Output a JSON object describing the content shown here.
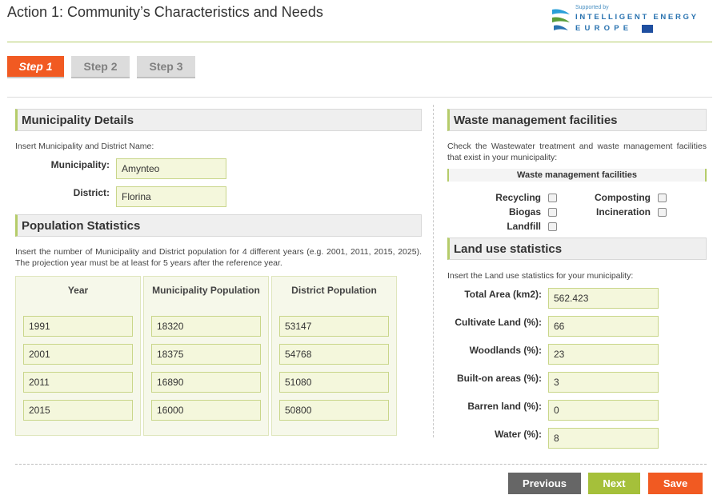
{
  "header": {
    "title": "Action 1: Community’s Characteristics and Needs",
    "logo": {
      "supported_by": "Supported by",
      "line1": "INTELLIGENT ENERGY",
      "line2": "EUROPE"
    }
  },
  "steps": [
    {
      "label": "Step 1",
      "active": true
    },
    {
      "label": "Step 2",
      "active": false
    },
    {
      "label": "Step 3",
      "active": false
    }
  ],
  "municipality_details": {
    "heading": "Municipality Details",
    "instruction": "Insert Municipality and District Name:",
    "municipality_label": "Municipality:",
    "municipality_value": "Amynteo",
    "district_label": "District:",
    "district_value": "Florina"
  },
  "population": {
    "heading": "Population Statistics",
    "instruction": "Insert the number of Municipality and District population for 4 different years (e.g. 2001, 2011, 2015, 2025). The projection year must be at least for 5 years after the reference year.",
    "columns": [
      "Year",
      "Municipality Population",
      "District Population"
    ],
    "rows": [
      [
        "1991",
        "18320",
        "53147"
      ],
      [
        "2001",
        "18375",
        "54768"
      ],
      [
        "2011",
        "16890",
        "51080"
      ],
      [
        "2015",
        "16000",
        "50800"
      ]
    ]
  },
  "waste": {
    "heading": "Waste management facilities",
    "instruction": "Check the Wastewater treatment and waste management facilities that exist in your municipality:",
    "subheading": "Waste management facilities",
    "options": [
      {
        "label": "Recycling",
        "checked": false
      },
      {
        "label": "Composting",
        "checked": false
      },
      {
        "label": "Biogas",
        "checked": false
      },
      {
        "label": "Incineration",
        "checked": false
      },
      {
        "label": "Landfill",
        "checked": false
      }
    ]
  },
  "land_use": {
    "heading": "Land use statistics",
    "instruction": "Insert the Land use statistics for your municipality:",
    "fields": [
      {
        "label": "Total Area (km2):",
        "value": "562.423"
      },
      {
        "label": "Cultivate Land (%):",
        "value": "66"
      },
      {
        "label": "Woodlands (%):",
        "value": "23"
      },
      {
        "label": "Built-on areas (%):",
        "value": "3"
      },
      {
        "label": "Barren land (%):",
        "value": "0"
      },
      {
        "label": "Water (%):",
        "value": "8"
      }
    ]
  },
  "buttons": {
    "previous": "Previous",
    "next": "Next",
    "save": "Save"
  },
  "colors": {
    "accent_orange": "#f15a22",
    "accent_green": "#a5c03a",
    "input_bg": "#f4f7dc",
    "button_gray": "#666666"
  }
}
